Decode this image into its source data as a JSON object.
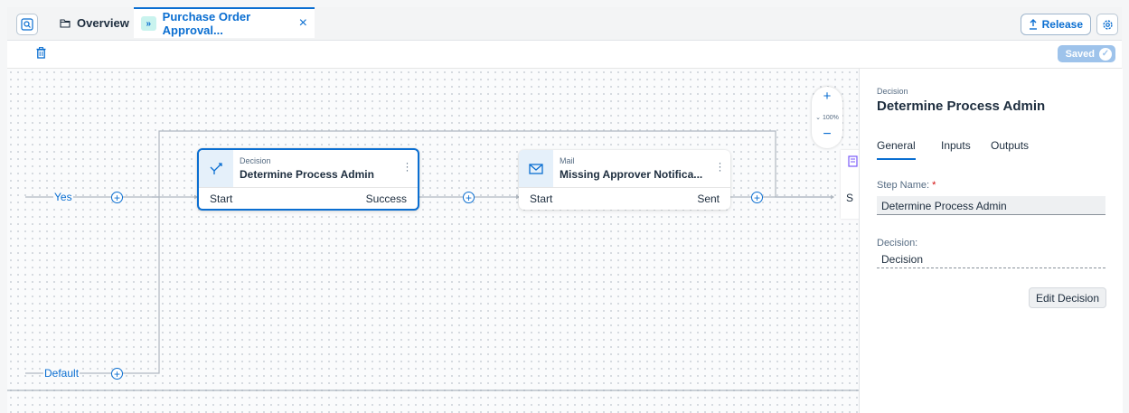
{
  "tabs": {
    "overview_label": "Overview",
    "active_label": "Purchase Order Approval...",
    "active_badge": "»",
    "close_glyph": "×"
  },
  "header": {
    "release_label": "Release"
  },
  "toolbar": {
    "saved_label": "Saved"
  },
  "canvas": {
    "branches": [
      {
        "label": "Yes"
      },
      {
        "label": "Default"
      }
    ],
    "nodes": [
      {
        "type": "Decision",
        "title": "Determine Process Admin",
        "start": "Start",
        "end": "Success",
        "icon": "decision-icon"
      },
      {
        "type": "Mail",
        "title": "Missing Approver Notifica...",
        "start": "Start",
        "end": "Sent",
        "icon": "mail-icon"
      }
    ],
    "partial_node_start": "S",
    "zoom": {
      "in_glyph": "+",
      "level": "100%",
      "out_glyph": "−"
    }
  },
  "panel": {
    "type": "Decision",
    "title": "Determine Process Admin",
    "tabs": [
      "General",
      "Inputs",
      "Outputs"
    ],
    "step_name_label": "Step Name:",
    "required_marker": "*",
    "step_name_value": "Determine Process Admin",
    "decision_label": "Decision:",
    "decision_value": "Decision",
    "edit_button": "Edit Decision"
  },
  "colors": {
    "accent": "#0a6ed1",
    "saved_badge": "#9ec3eb",
    "tab_badge": "#c9f3ee"
  }
}
